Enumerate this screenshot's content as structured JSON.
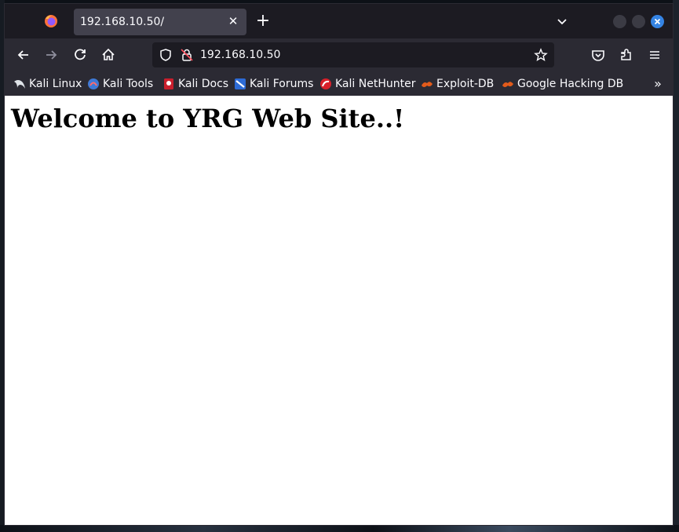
{
  "browser": {
    "tab": {
      "title": "192.168.10.50/"
    },
    "urlbar": {
      "url": "192.168.10.50"
    }
  },
  "bookmarks": [
    {
      "label": "Kali Linux",
      "icon": "kali-dragon-icon"
    },
    {
      "label": "Kali Tools",
      "icon": "kali-tools-icon"
    },
    {
      "label": "Kali Docs",
      "icon": "kali-docs-icon"
    },
    {
      "label": "Kali Forums",
      "icon": "kali-forums-icon"
    },
    {
      "label": "Kali NetHunter",
      "icon": "kali-nethunter-icon"
    },
    {
      "label": "Exploit-DB",
      "icon": "exploit-db-icon"
    },
    {
      "label": "Google Hacking DB",
      "icon": "ghdb-icon"
    }
  ],
  "page": {
    "heading": "Welcome to YRG Web Site..!"
  },
  "colors": {
    "toolbar": "#2b2a33",
    "tabstrip": "#1c1b22",
    "close_button": "#3584e4",
    "exploit_db_orange": "#e25b1b"
  }
}
